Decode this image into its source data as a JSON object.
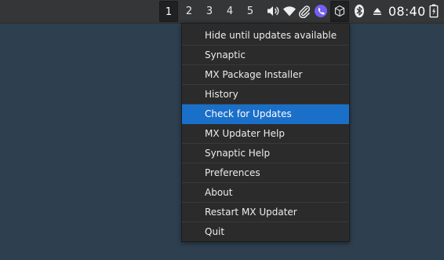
{
  "panel": {
    "workspaces": [
      "1",
      "2",
      "3",
      "4",
      "5"
    ],
    "active_workspace": "1",
    "tray_icons": [
      "volume-icon",
      "wifi-icon",
      "paperclip-icon",
      "viber-icon",
      "package-updater-icon",
      "bluetooth-icon",
      "eject-icon",
      "battery-icon"
    ],
    "clock": "08:40"
  },
  "menu": {
    "items": [
      "Hide until updates available",
      "Synaptic",
      "MX Package Installer",
      "History",
      "Check for Updates",
      "MX Updater Help",
      "Synaptic Help",
      "Preferences",
      "About",
      "Restart MX Updater",
      "Quit"
    ],
    "highlighted": "Check for Updates"
  },
  "colors": {
    "desktop": "#2e4050",
    "panel": "#353637",
    "menu_bg": "#2b2b2b",
    "highlight": "#1a6fc9",
    "viber_purple": "#7360f2"
  }
}
